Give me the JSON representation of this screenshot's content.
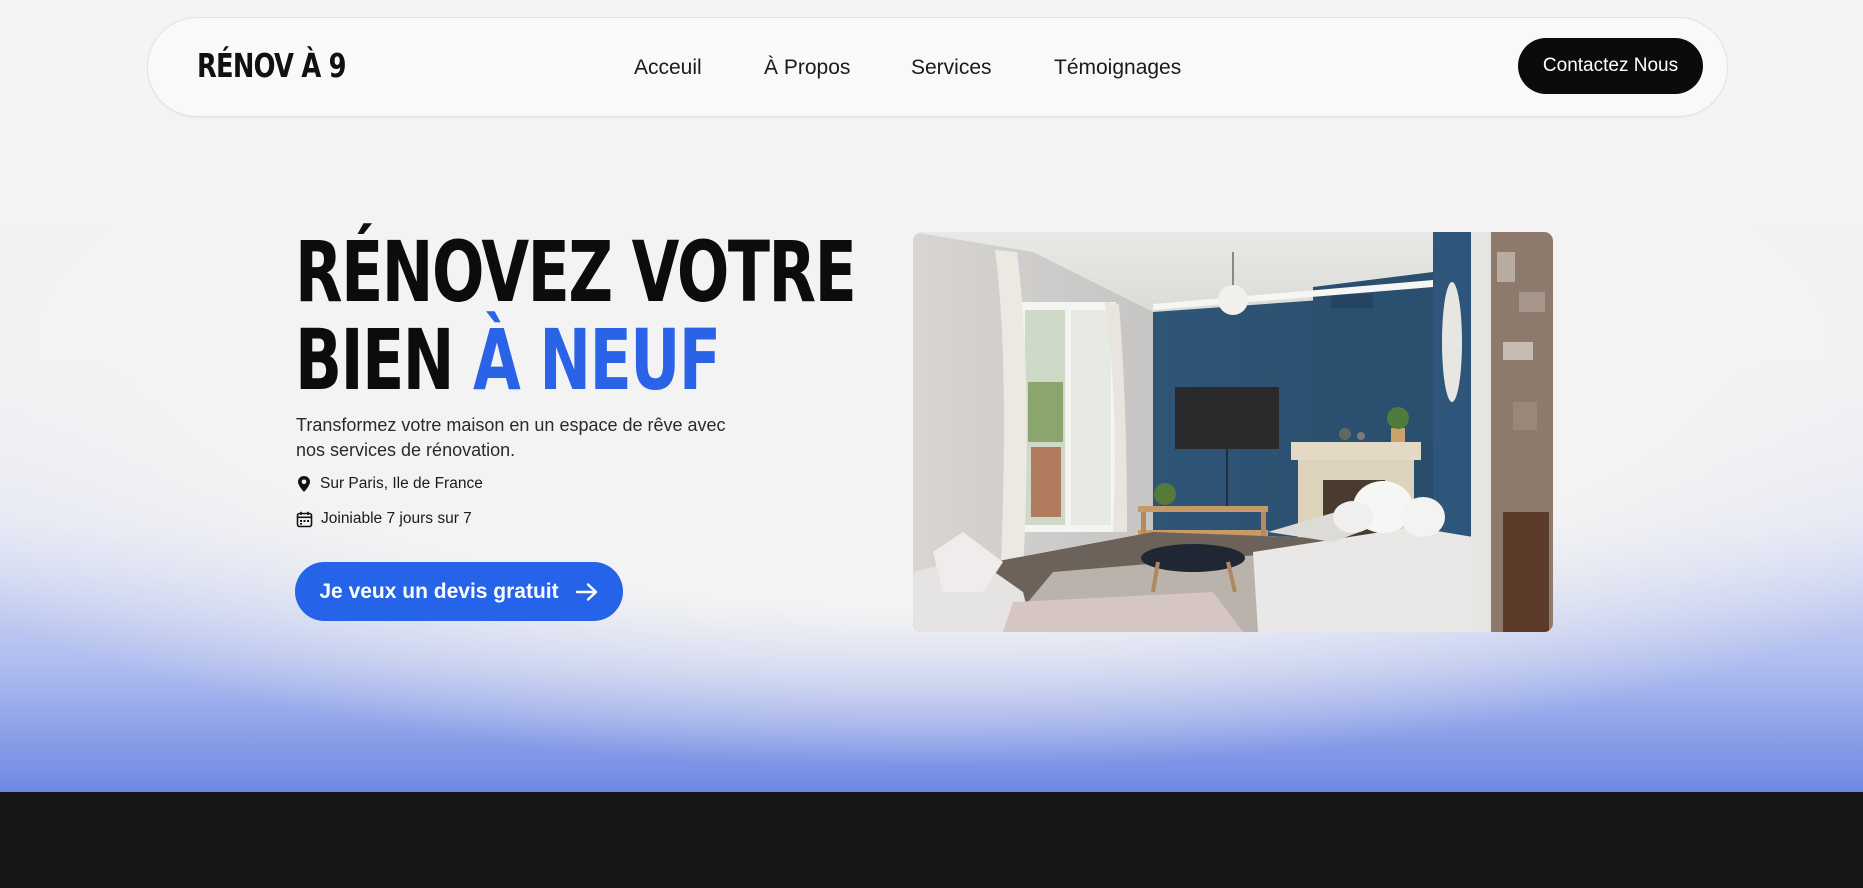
{
  "brand": {
    "logo_text": "RÉNOV À 9"
  },
  "nav": {
    "links": [
      "Acceuil",
      "À Propos",
      "Services",
      "Témoignages"
    ],
    "cta_label": "Contactez Nous"
  },
  "hero": {
    "headline_line1": "RÉNOVEZ VOTRE",
    "headline_line2_plain": "BIEN",
    "headline_line2_accent": "À NEUF",
    "subtitle": "Transformez votre maison en un espace de rêve avec nos services de rénovation.",
    "location_text": "Sur Paris, Ile de France",
    "availability_text": "Joiniable 7 jours sur 7",
    "cta_label": "Je veux un devis gratuit",
    "icons": [
      "location-pin-icon",
      "calendar-icon",
      "arrow-right-icon"
    ],
    "image": "renovated-living-room-photo"
  },
  "colors": {
    "accent": "#2563e8",
    "dark": "#0b0b0b",
    "footer": "#161618",
    "wall_blue": "#2f5577"
  }
}
